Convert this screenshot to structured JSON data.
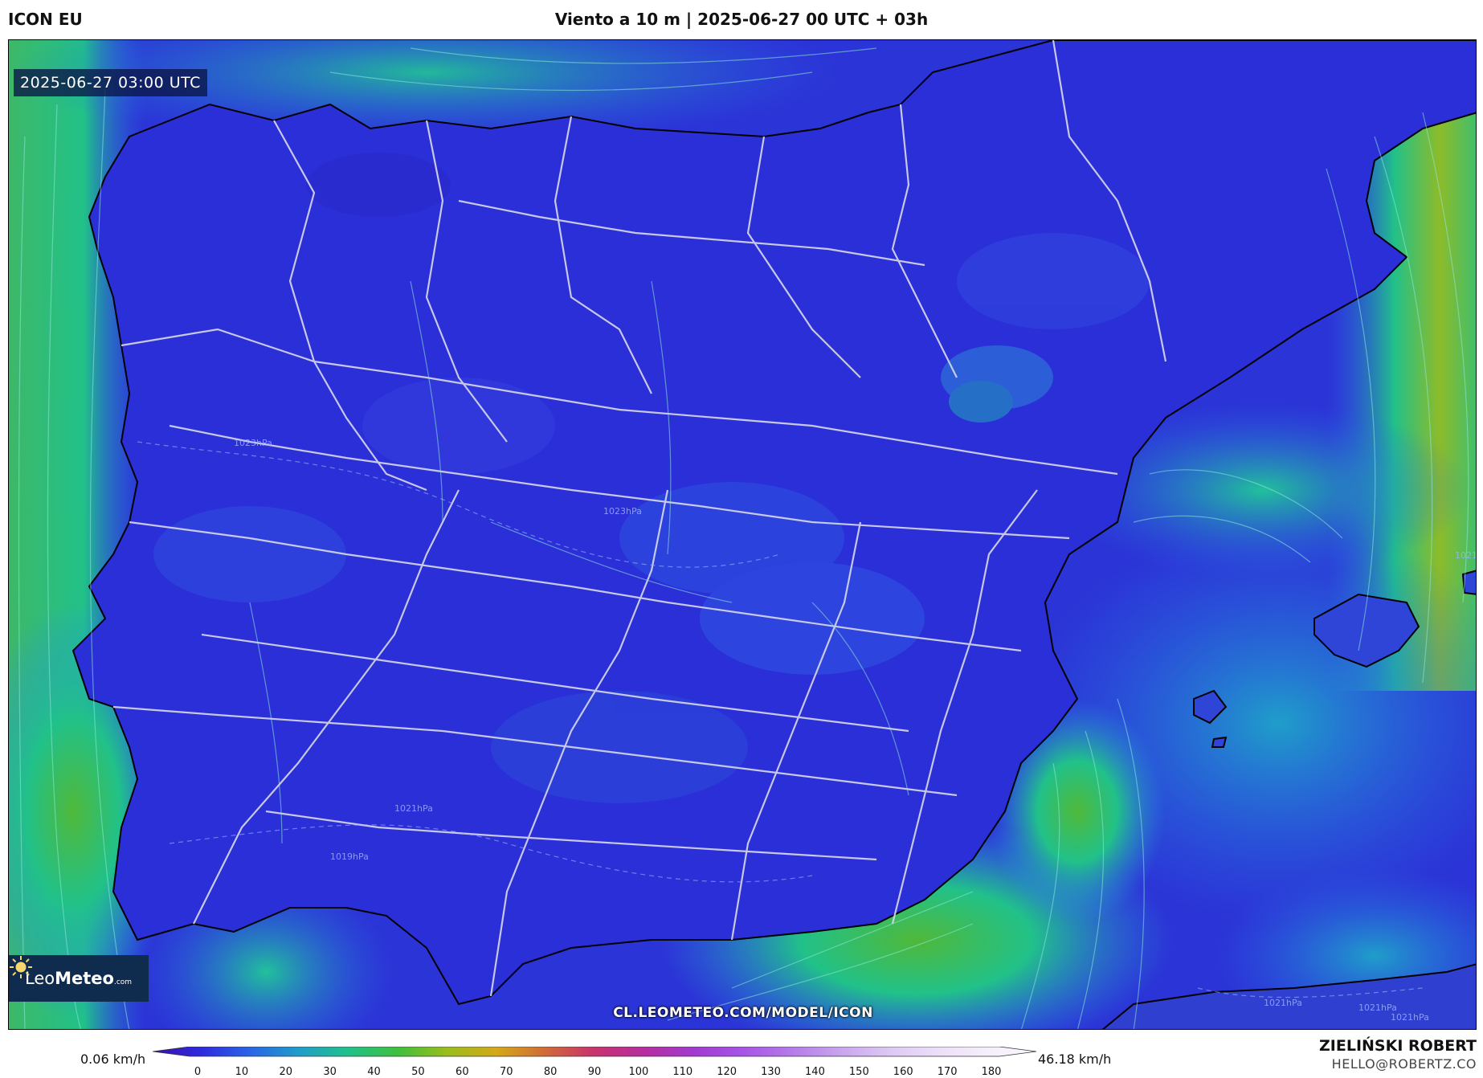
{
  "header": {
    "model": "ICON EU",
    "title": "Viento a 10 m | 2025-06-27 00 UTC + 03h"
  },
  "map": {
    "valid_time": "2025-06-27 03:00 UTC",
    "logo": {
      "leo": "Leo",
      "meteo": "Meteo",
      "com": ".com"
    },
    "url": "CL.LEOMETEO.COM/MODEL/ICON",
    "isobar_labels": [
      "1023hPa",
      "1023hPa",
      "1021hPa",
      "1021hPa",
      "1019hPa",
      "1021hPa",
      "1021hPa",
      "1021hPa",
      "1021hPa",
      "1021hPa"
    ]
  },
  "colorbar": {
    "min_label": "0.06 km/h",
    "max_label": "46.18 km/h",
    "ticks": [
      "0",
      "10",
      "20",
      "30",
      "40",
      "50",
      "60",
      "70",
      "80",
      "90",
      "100",
      "110",
      "120",
      "130",
      "140",
      "150",
      "160",
      "170",
      "180"
    ],
    "colors": [
      "#3a0fb0",
      "#2f2be0",
      "#2a66e6",
      "#1f9ec9",
      "#21c189",
      "#3fbf3e",
      "#9bbd1c",
      "#d4a81a",
      "#d06a38",
      "#c8326e",
      "#b62ea0",
      "#a23ad0",
      "#a653e6",
      "#b57ae8",
      "#c8a4ee",
      "#dcc8f3",
      "#ecdff8",
      "#f5eefb",
      "#fbf8fd"
    ]
  },
  "footer": {
    "author": "ZIELIŃSKI ROBERT",
    "email": "HELLO@ROBERTZ.CO"
  }
}
